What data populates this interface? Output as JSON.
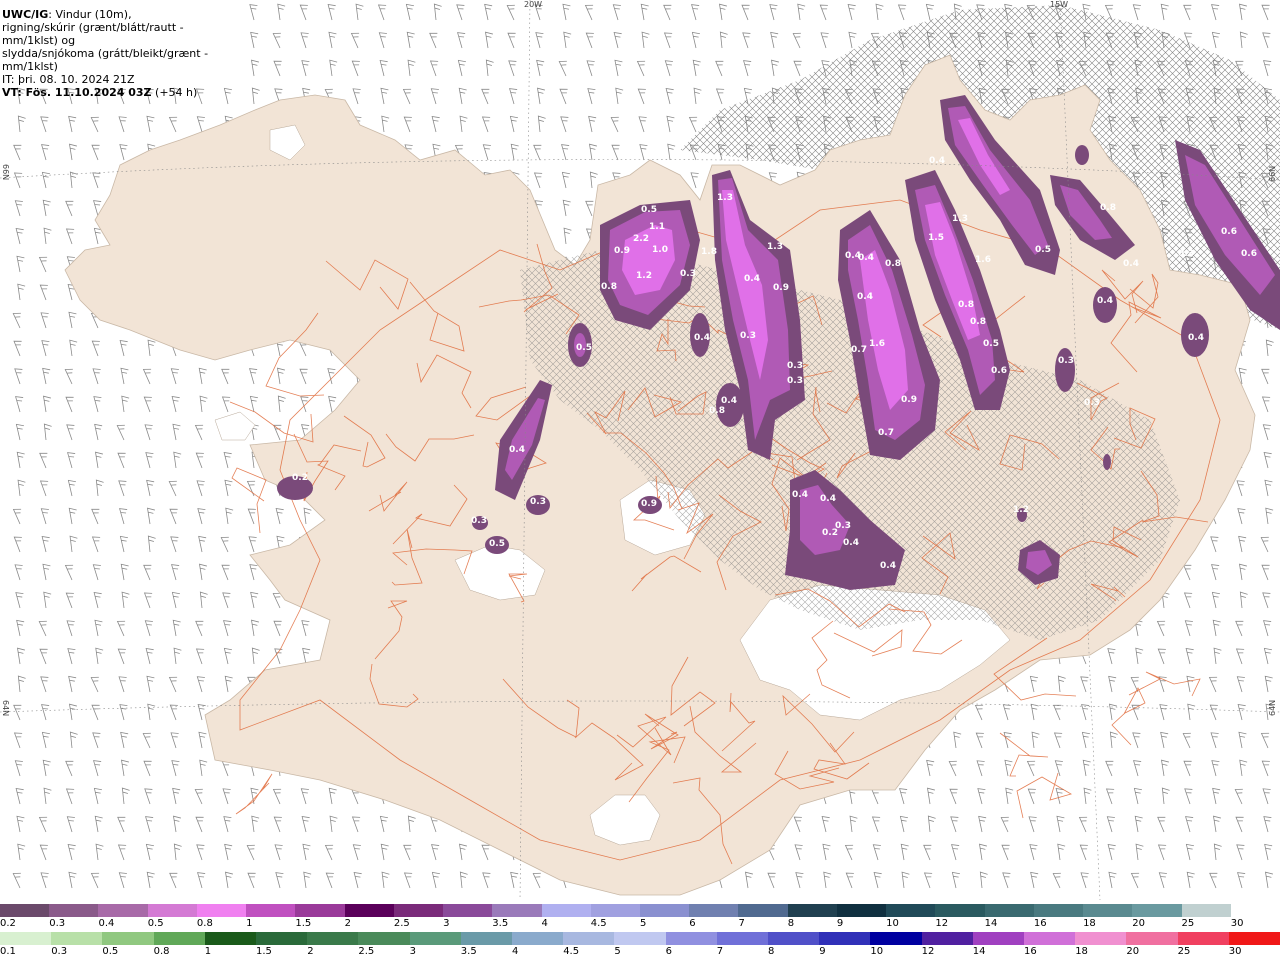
{
  "header": {
    "model": "UWC/IG",
    "desc_line1": ": Vindur (10m),",
    "desc_line2": "rigning/skúrir (grænt/blátt/rautt - mm/1klst) og",
    "desc_line3": "slydda/snjókoma (grátt/bleikt/grænt - mm/1klst)",
    "it_label": "IT:",
    "it_value": " þri. 08. 10. 2024 21Z",
    "vt_label": "VT: Fös. 11.10.2024 03Z",
    "vt_offset": " (+54 h)"
  },
  "axis_labels": {
    "lon_20w": "20W",
    "lon_15w": "15W",
    "lat_66n_left": "66N",
    "lat_66n_right": "66N",
    "lat_64n_left": "64N",
    "lat_64n_right": "64N"
  },
  "colors": {
    "land": "#f2e4d6",
    "ice": "#ffffff",
    "sea": "#ffffff",
    "roads": "#e06a3a",
    "barbs": "#8a8a8a",
    "precip_light": "#7a4a7a",
    "precip_mid": "#b05ab5",
    "precip_high": "#e070e8"
  },
  "precip_labels": [
    "0.5",
    "2.2",
    "1.1",
    "0.9",
    "1.0",
    "1.2",
    "0.8",
    "0.3",
    "1.8",
    "1.3",
    "1.3",
    "0.4",
    "0.9",
    "0.3",
    "0.5",
    "0.3",
    "0.4",
    "0.4",
    "0.8",
    "0.3",
    "1.6",
    "0.4",
    "0.9",
    "0.7",
    "0.7",
    "0.4",
    "1.3",
    "1.5",
    "1.6",
    "0.8",
    "0.8",
    "0.5",
    "0.6",
    "0.5",
    "0.4",
    "0.3",
    "0.3",
    "0.4",
    "0.3",
    "0.4",
    "0.6",
    "0.6",
    "0.4",
    "0.4",
    "0.4",
    "0.8",
    "0.4",
    "0.4",
    "0.4",
    "0.3",
    "0.2",
    "0.9",
    "0.4",
    "0.3",
    "0.5",
    "0.3",
    "0.2",
    "1.2",
    "0.8"
  ],
  "legend_snow": {
    "labels": [
      "0.2",
      "0.3",
      "0.4",
      "0.5",
      "0.8",
      "1",
      "1.5",
      "2",
      "2.5",
      "3",
      "3.5",
      "4",
      "4.5",
      "5",
      "6",
      "7",
      "8",
      "9",
      "10",
      "12",
      "14",
      "16",
      "18",
      "20",
      "25",
      "30"
    ],
    "colors": [
      "#6b4a6b",
      "#8a5a8a",
      "#a86aa8",
      "#d47ad4",
      "#f080f0",
      "#c050c0",
      "#9a3a9a",
      "#5a005a",
      "#7a2a7a",
      "#8a4a9a",
      "#9a7aba",
      "#b0b0f0",
      "#a0a0e0",
      "#8a90d0",
      "#7080b0",
      "#506a90",
      "#204050",
      "#103040",
      "#204a58",
      "#2a5a60",
      "#3a6a70",
      "#4a7a80",
      "#5a8a90",
      "#6a9aa0",
      "#c0d0d0",
      "#ffffff"
    ]
  },
  "legend_rain": {
    "labels": [
      "0.1",
      "0.3",
      "0.5",
      "0.8",
      "1",
      "1.5",
      "2",
      "2.5",
      "3",
      "3.5",
      "4",
      "4.5",
      "5",
      "6",
      "7",
      "8",
      "9",
      "10",
      "12",
      "14",
      "16",
      "18",
      "20",
      "25",
      "30"
    ],
    "colors": [
      "#d8f0d0",
      "#b8e0a8",
      "#90c880",
      "#60a858",
      "#1a5a1a",
      "#2a6a3a",
      "#3a7a4a",
      "#4a8a5a",
      "#5a9a7a",
      "#6a9aa8",
      "#8aaacc",
      "#a8b8e0",
      "#c0c8f0",
      "#9090e0",
      "#7070d8",
      "#5050c8",
      "#3030b8",
      "#0000a0",
      "#5020a0",
      "#a040c0",
      "#d070d8",
      "#f090d0",
      "#f070a0",
      "#f04060",
      "#f01818"
    ]
  }
}
